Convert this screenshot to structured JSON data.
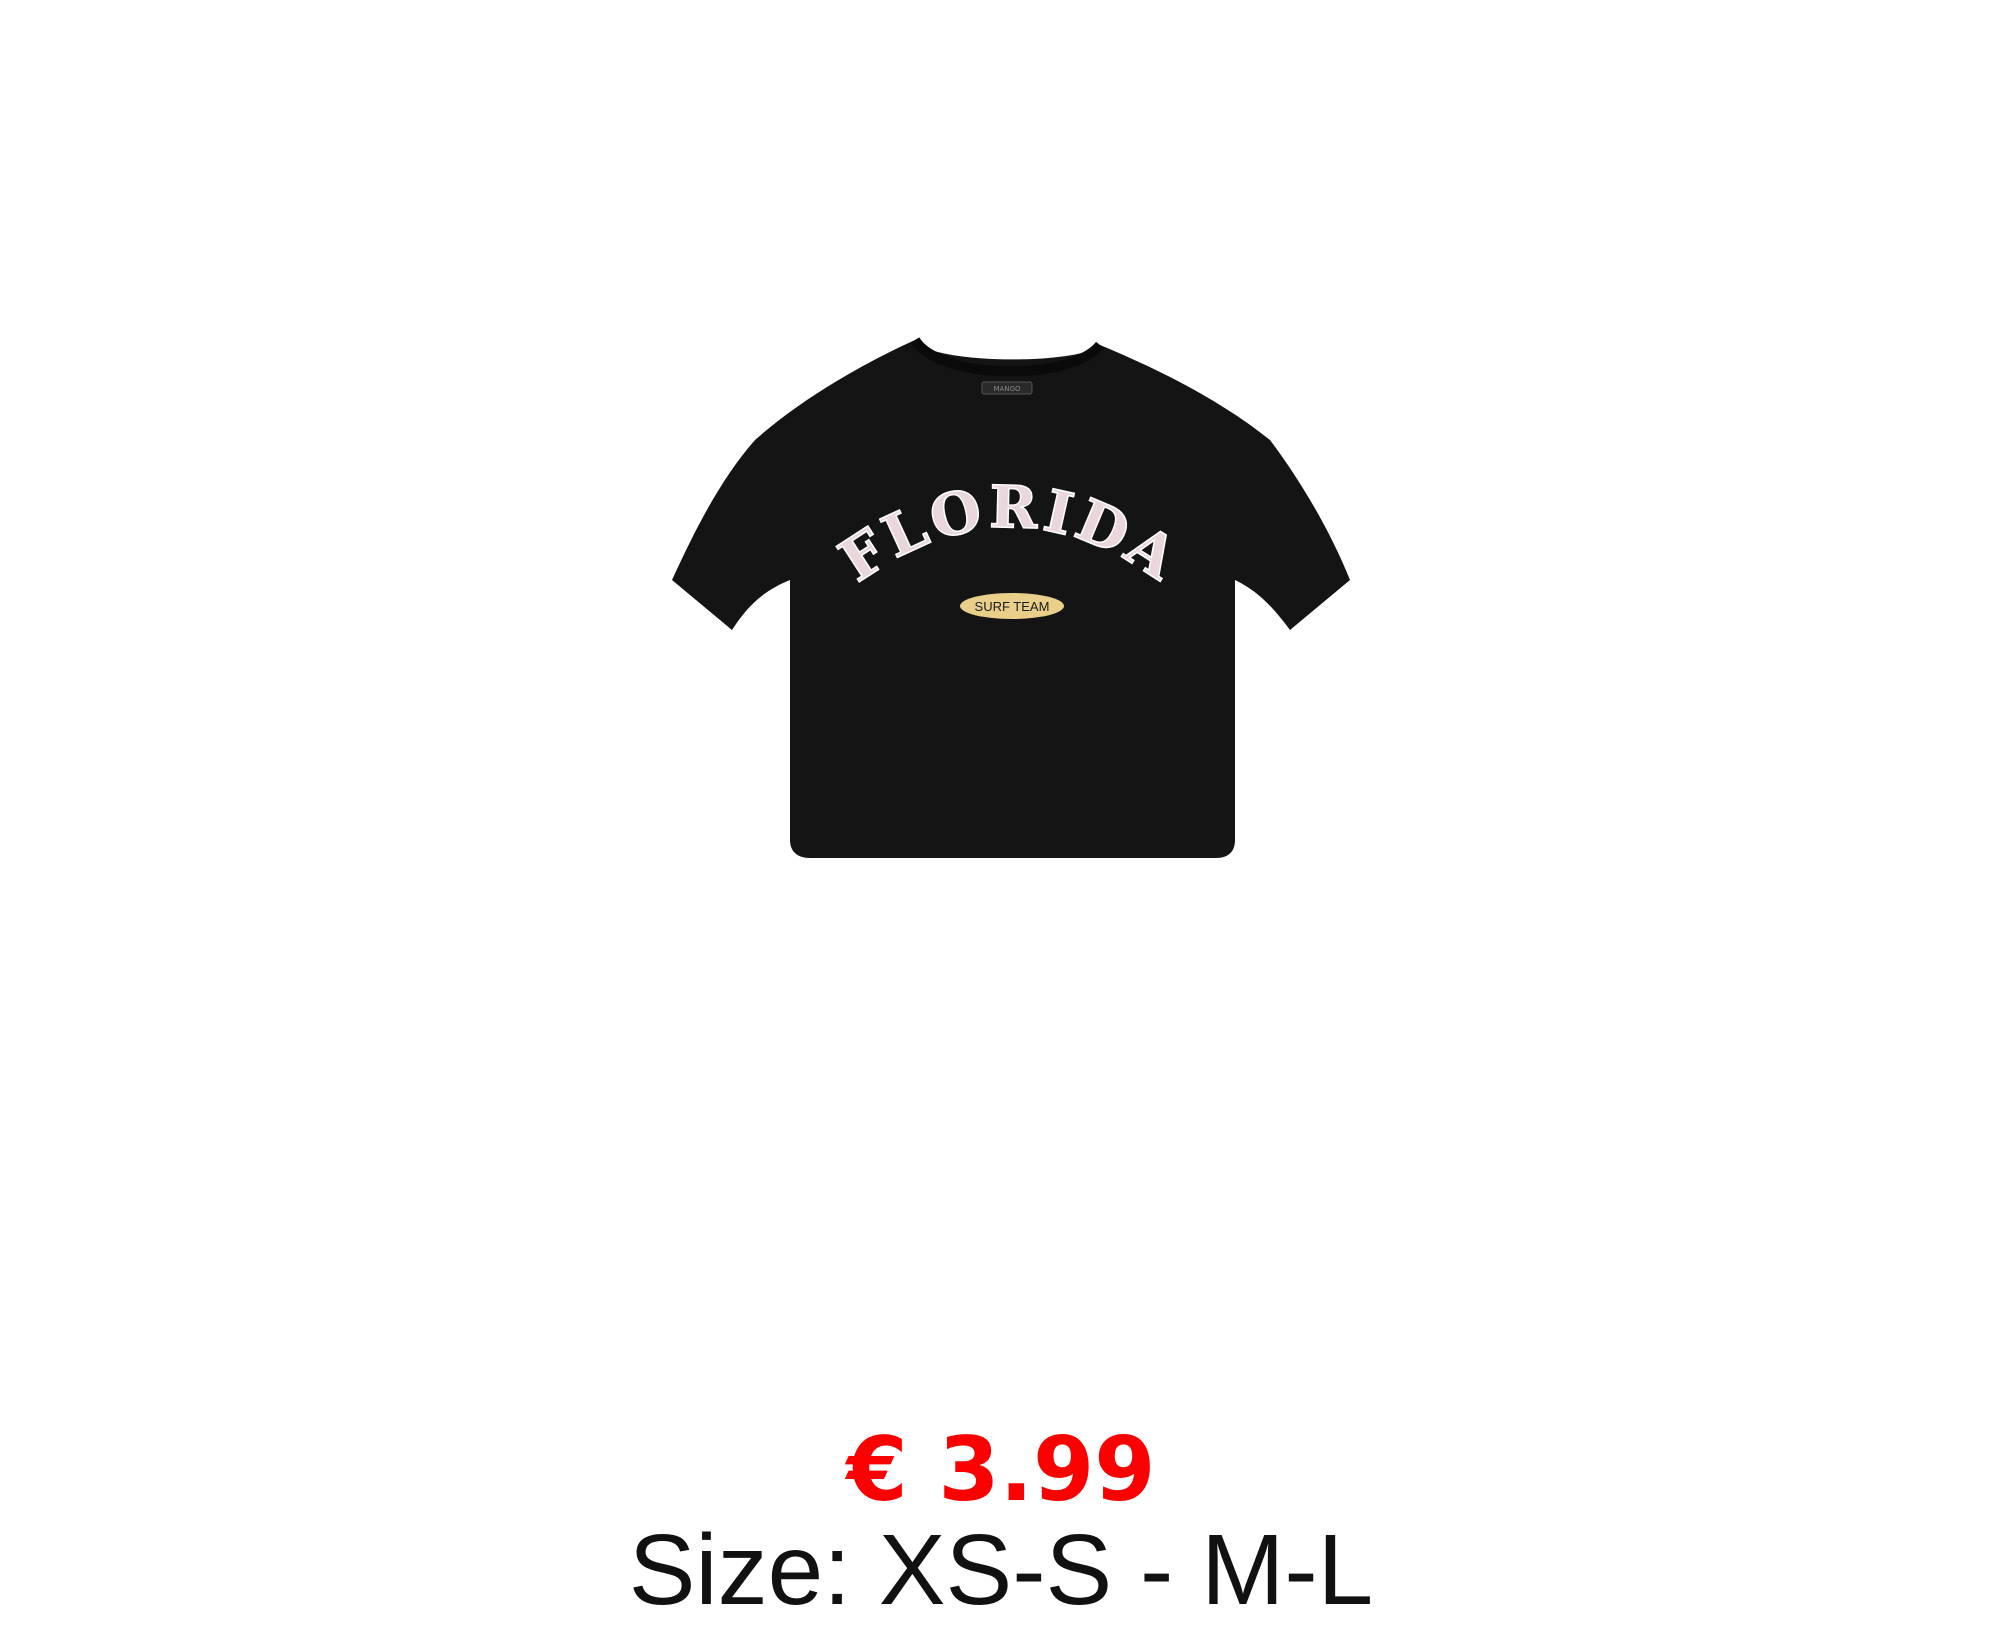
{
  "product": {
    "image_alt": "black cropped t-shirt",
    "print": {
      "main_text": "FLORIDA",
      "badge_text": "SURF TEAM",
      "label_text": "MANGO"
    },
    "price": "€ 3.99",
    "size": "Size: XS-S - M-L"
  },
  "colors": {
    "price": "#fb0000",
    "size_text": "#111111",
    "shirt": "#141414",
    "print_text": "#ead7dc",
    "badge": "#e9cf8a"
  }
}
